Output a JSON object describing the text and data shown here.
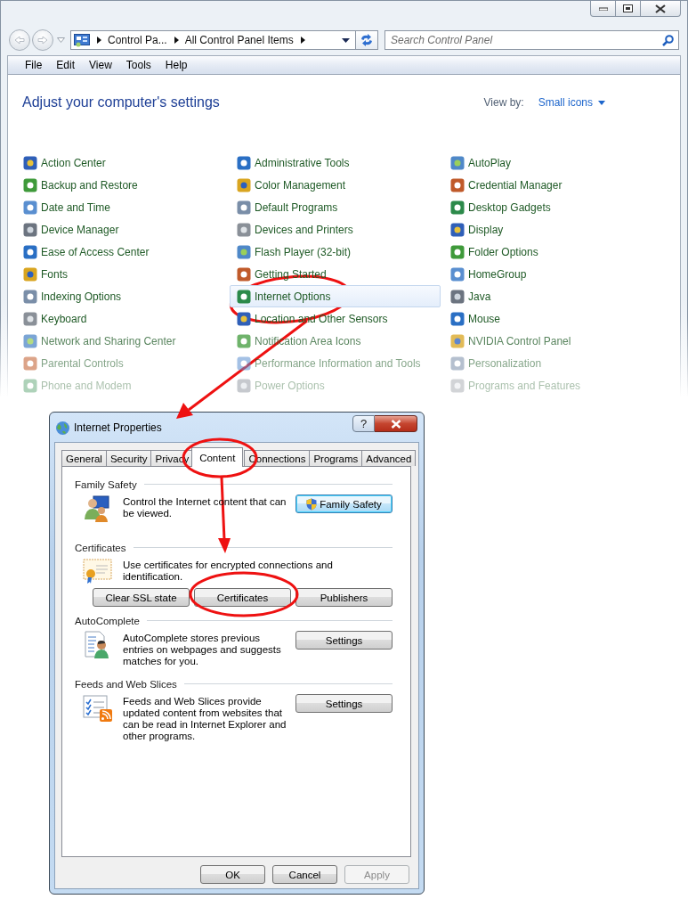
{
  "control_panel": {
    "breadcrumbs": [
      "Control Pa...",
      "All Control Panel Items"
    ],
    "search": {
      "placeholder": "Search Control Panel"
    },
    "menu": [
      "File",
      "Edit",
      "View",
      "Tools",
      "Help"
    ],
    "heading": "Adjust your computer's settings",
    "view_by": {
      "label": "View by:",
      "value": "Small icons"
    },
    "columns": [
      {
        "items": [
          {
            "label": "Action Center",
            "selected": false
          },
          {
            "label": "Backup and Restore",
            "selected": false
          },
          {
            "label": "Date and Time",
            "selected": false
          },
          {
            "label": "Device Manager",
            "selected": false
          },
          {
            "label": "Ease of Access Center",
            "selected": false
          },
          {
            "label": "Fonts",
            "selected": false
          },
          {
            "label": "Indexing Options",
            "selected": false
          },
          {
            "label": "Keyboard",
            "selected": false
          },
          {
            "label": "Network and Sharing Center",
            "selected": false
          },
          {
            "label": "Parental Controls",
            "selected": false
          },
          {
            "label": "Phone and Modem",
            "selected": false
          }
        ]
      },
      {
        "items": [
          {
            "label": "Administrative Tools",
            "selected": false
          },
          {
            "label": "Color Management",
            "selected": false
          },
          {
            "label": "Default Programs",
            "selected": false
          },
          {
            "label": "Devices and Printers",
            "selected": false
          },
          {
            "label": "Flash Player (32-bit)",
            "selected": false
          },
          {
            "label": "Getting Started",
            "selected": false
          },
          {
            "label": "Internet Options",
            "selected": true
          },
          {
            "label": "Location and Other Sensors",
            "selected": false
          },
          {
            "label": "Notification Area Icons",
            "selected": false
          },
          {
            "label": "Performance Information and Tools",
            "selected": false
          },
          {
            "label": "Power Options",
            "selected": false
          }
        ]
      },
      {
        "items": [
          {
            "label": "AutoPlay",
            "selected": false
          },
          {
            "label": "Credential Manager",
            "selected": false
          },
          {
            "label": "Desktop Gadgets",
            "selected": false
          },
          {
            "label": "Display",
            "selected": false
          },
          {
            "label": "Folder Options",
            "selected": false
          },
          {
            "label": "HomeGroup",
            "selected": false
          },
          {
            "label": "Java",
            "selected": false
          },
          {
            "label": "Mouse",
            "selected": false
          },
          {
            "label": "NVIDIA Control Panel",
            "selected": false
          },
          {
            "label": "Personalization",
            "selected": false
          },
          {
            "label": "Programs and Features",
            "selected": false
          }
        ]
      }
    ]
  },
  "dialog": {
    "title": "Internet Properties",
    "help_button": "?",
    "tabs": [
      {
        "label": "General",
        "selected": false
      },
      {
        "label": "Security",
        "selected": false
      },
      {
        "label": "Privacy",
        "selected": false
      },
      {
        "label": "Content",
        "selected": true
      },
      {
        "label": "Connections",
        "selected": false
      },
      {
        "label": "Programs",
        "selected": false
      },
      {
        "label": "Advanced",
        "selected": false
      }
    ],
    "sections": [
      {
        "title": "Family Safety",
        "kind": "side",
        "text": "Control the Internet content that can be viewed.",
        "buttons": [
          {
            "label": "Family Safety",
            "kind": "elevated",
            "focused": true
          }
        ]
      },
      {
        "title": "Certificates",
        "kind": "row",
        "text": "Use certificates for encrypted connections and identification.",
        "buttons": [
          {
            "label": "Clear SSL state",
            "kind": "plain",
            "focused": false
          },
          {
            "label": "Certificates",
            "kind": "plain",
            "focused": false
          },
          {
            "label": "Publishers",
            "kind": "plain",
            "focused": false
          }
        ]
      },
      {
        "title": "AutoComplete",
        "kind": "side",
        "text": "AutoComplete stores previous entries on webpages and suggests matches for you.",
        "buttons": [
          {
            "label": "Settings",
            "kind": "plain",
            "focused": false
          }
        ]
      },
      {
        "title": "Feeds and Web Slices",
        "kind": "side",
        "text": "Feeds and Web Slices provide updated content from websites that can be read in Internet Explorer and other programs.",
        "buttons": [
          {
            "label": "Settings",
            "kind": "plain",
            "focused": false
          }
        ]
      }
    ],
    "footer_buttons": [
      {
        "label": "OK",
        "disabled": false
      },
      {
        "label": "Cancel",
        "disabled": false
      },
      {
        "label": "Apply",
        "disabled": true
      }
    ]
  }
}
